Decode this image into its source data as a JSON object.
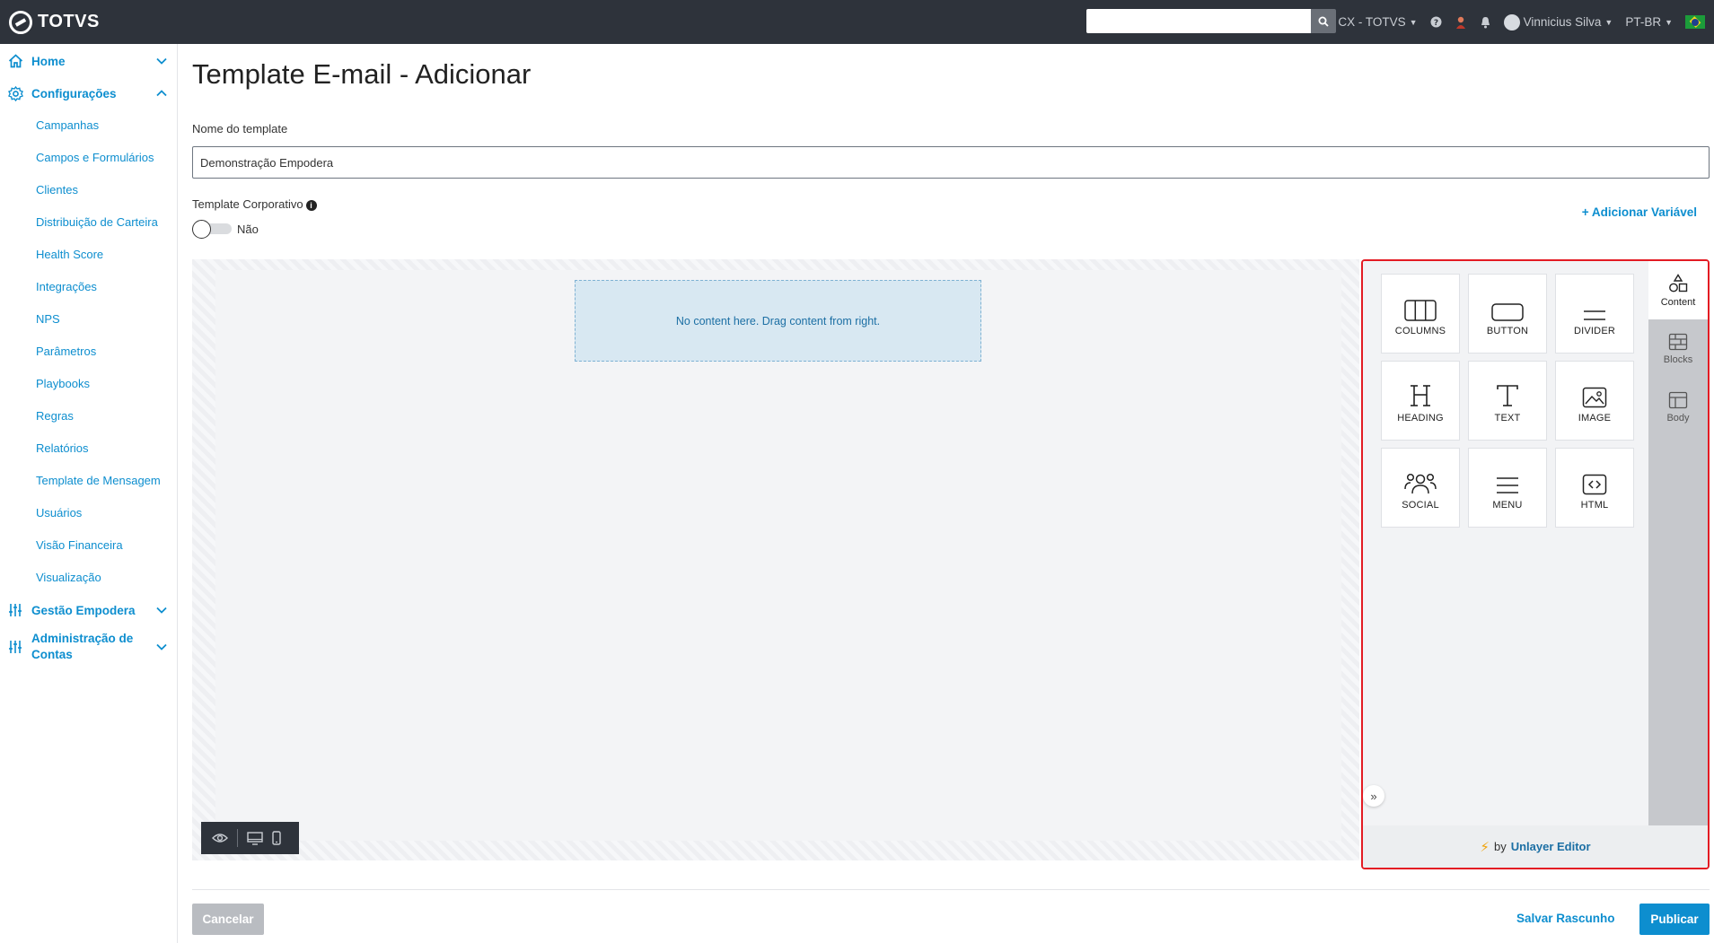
{
  "header": {
    "brand": "TOTVS",
    "search_placeholder": "",
    "org": "CX - TOTVS",
    "user": "Vinnicius Silva",
    "language": "PT-BR"
  },
  "sidebar": {
    "home": "Home",
    "config": "Configurações",
    "items": [
      "Campanhas",
      "Campos e Formulários",
      "Clientes",
      "Distribuição de Carteira",
      "Health Score",
      "Integrações",
      "NPS",
      "Parâmetros",
      "Playbooks",
      "Regras",
      "Relatórios",
      "Template de Mensagem",
      "Usuários",
      "Visão Financeira",
      "Visualização"
    ],
    "gestao": "Gestão Empodera",
    "admin_line1": "Administração de",
    "admin_line2": "Contas"
  },
  "page": {
    "title": "Template E-mail - Adicionar",
    "name_label": "Nome do template",
    "name_value": "Demonstração Empodera",
    "corp_label": "Template Corporativo",
    "toggle_label": "Não",
    "add_variable": "+ Adicionar Variável"
  },
  "editor": {
    "drop_text": "No content here. Drag content from right.",
    "tools": [
      "COLUMNS",
      "BUTTON",
      "DIVIDER",
      "HEADING",
      "TEXT",
      "IMAGE",
      "SOCIAL",
      "MENU",
      "HTML"
    ],
    "tabs": [
      "Content",
      "Blocks",
      "Body"
    ],
    "footer_by": "by",
    "footer_brand": "Unlayer Editor"
  },
  "actions": {
    "cancel": "Cancelar",
    "draft": "Salvar Rascunho",
    "publish": "Publicar"
  },
  "colors": {
    "accent": "#0d8ecf",
    "topbar": "#2e333b",
    "highlight": "#e31b23"
  }
}
